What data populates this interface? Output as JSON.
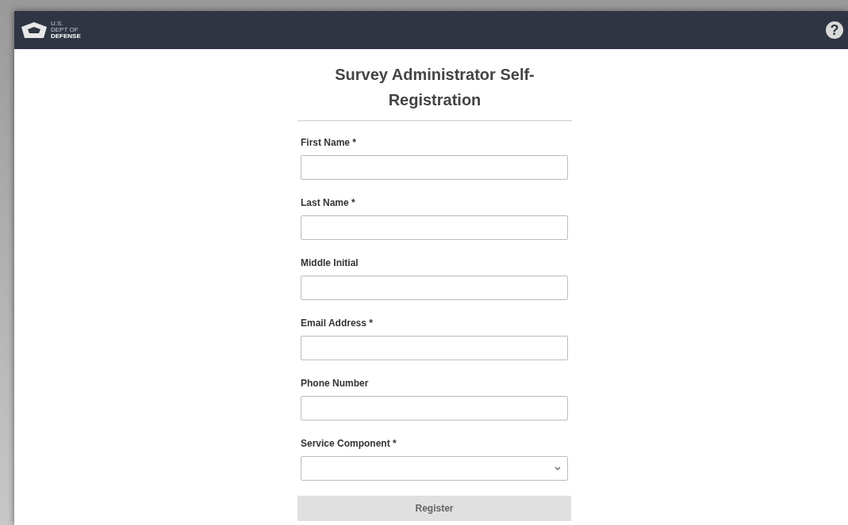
{
  "header": {
    "logo_lines": [
      "U.S.",
      "DEPT OF",
      "DEFENSE"
    ],
    "help": "?"
  },
  "title": "Survey Administrator Self-Registration",
  "fields": [
    {
      "label": "First Name *",
      "kind": "text"
    },
    {
      "label": "Last Name *",
      "kind": "text"
    },
    {
      "label": "Middle Initial",
      "kind": "text"
    },
    {
      "label": "Email Address *",
      "kind": "text"
    },
    {
      "label": "Phone Number",
      "kind": "text"
    },
    {
      "label": "Service Component *",
      "kind": "select"
    }
  ],
  "button": {
    "label": "Register",
    "disabled": true
  }
}
